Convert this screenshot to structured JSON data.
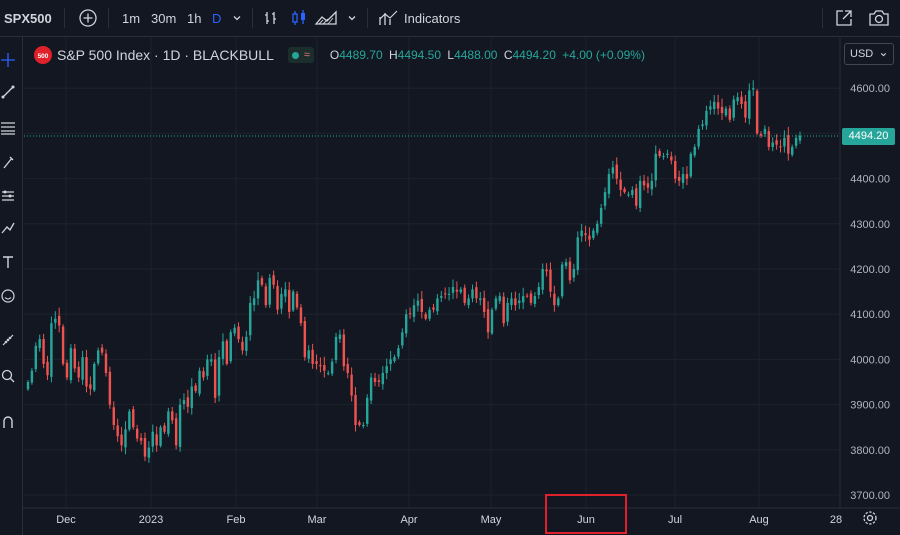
{
  "toolbar": {
    "symbol": "SPX500",
    "intervals": [
      "1m",
      "30m",
      "1h",
      "D"
    ],
    "active_interval": "D",
    "indicators_label": "Indicators"
  },
  "legend": {
    "badge": "500",
    "title": "S&P 500 Index · 1D · BLACKBULL",
    "open_label": "O",
    "open": "4489.70",
    "high_label": "H",
    "high": "4494.50",
    "low_label": "L",
    "low": "4488.00",
    "close_label": "C",
    "close": "4494.20",
    "change": "+4.00 (+0.09%)"
  },
  "currency": "USD",
  "last_price_tag": "4494.20",
  "colors": {
    "background": "#131722",
    "up": "#26a69a",
    "down": "#ef5350",
    "grid": "#1e222d",
    "highlight": "#e0212a"
  },
  "icons": [
    "add-symbol-icon",
    "chevron-down-icon",
    "bar-style-icon",
    "candles-icon",
    "area-icon",
    "indicators-icon",
    "fullscreen-icon",
    "camera-icon",
    "crosshair-icon",
    "trend-line-icon",
    "fib-icon",
    "brush-icon",
    "pattern-icon",
    "prediction-icon",
    "text-icon",
    "emoji-icon",
    "ruler-icon",
    "zoom-icon",
    "magnet-icon",
    "settings-gear-icon"
  ],
  "chart_data": {
    "type": "candlestick",
    "title": "S&P 500 Index · 1D · BLACKBULL",
    "ylim": [
      3700,
      4620
    ],
    "y_ticks": [
      "4600.00",
      "4500.00",
      "4400.00",
      "4300.00",
      "4200.00",
      "4100.00",
      "4000.00",
      "3900.00",
      "3800.00",
      "3700.00"
    ],
    "x_ticks": [
      "Dec",
      "2023",
      "Feb",
      "Mar",
      "Apr",
      "May",
      "Jun",
      "Jul",
      "Aug",
      "28"
    ],
    "last_price": 4494.2,
    "highlighted_label": "Jun",
    "close_series": [
      3950,
      3975,
      4030,
      4045,
      3990,
      3965,
      4080,
      4090,
      4075,
      3990,
      3960,
      4025,
      3980,
      3960,
      4005,
      3940,
      3935,
      3990,
      4020,
      4015,
      3970,
      3900,
      3855,
      3830,
      3810,
      3845,
      3885,
      3850,
      3825,
      3820,
      3785,
      3805,
      3840,
      3810,
      3850,
      3840,
      3885,
      3865,
      3810,
      3900,
      3910,
      3895,
      3940,
      3930,
      3975,
      3960,
      4000,
      4000,
      3915,
      4005,
      4040,
      3990,
      4060,
      4070,
      4045,
      4020,
      4050,
      4125,
      4135,
      4175,
      4165,
      4120,
      4180,
      4165,
      4110,
      4145,
      4155,
      4105,
      4150,
      4115,
      4080,
      4005,
      4020,
      3990,
      3990,
      3985,
      3975,
      3970,
      3995,
      4050,
      4055,
      3985,
      3970,
      3920,
      3855,
      3855,
      3855,
      3915,
      3960,
      3950,
      3950,
      3970,
      3985,
      4000,
      4005,
      4025,
      4060,
      4100,
      4100,
      4120,
      4130,
      4105,
      4090,
      4110,
      4110,
      4135,
      4140,
      4145,
      4145,
      4160,
      4150,
      4155,
      4125,
      4135,
      4155,
      4135,
      4135,
      4105,
      4060,
      4110,
      4135,
      4140,
      4080,
      4125,
      4135,
      4120,
      4130,
      4140,
      4140,
      4125,
      4140,
      4160,
      4200,
      4195,
      4150,
      4120,
      4135,
      4210,
      4215,
      4175,
      4200,
      4270,
      4285,
      4275,
      4265,
      4285,
      4300,
      4335,
      4370,
      4410,
      4425,
      4400,
      4375,
      4370,
      4365,
      4375,
      4340,
      4395,
      4385,
      4380,
      4395,
      4455,
      4450,
      4450,
      4455,
      4440,
      4400,
      4395,
      4410,
      4400,
      4455,
      4470,
      4510,
      4520,
      4550,
      4560,
      4570,
      4555,
      4545,
      4555,
      4530,
      4575,
      4580,
      4565,
      4535,
      4595,
      4600,
      4500,
      4495,
      4510,
      4470,
      4480,
      4475,
      4470,
      4490,
      4455,
      4470,
      4490,
      4495
    ]
  }
}
